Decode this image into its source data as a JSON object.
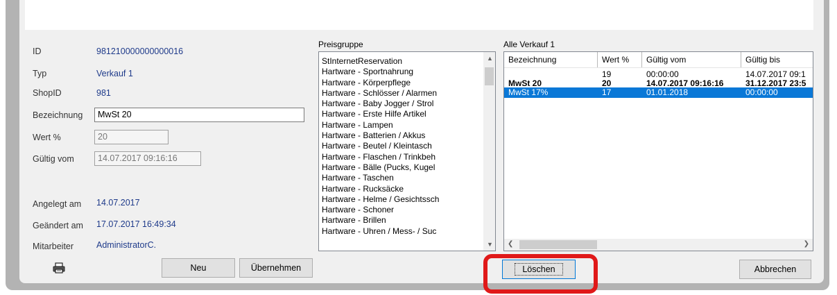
{
  "form": {
    "id_label": "ID",
    "id_value": "981210000000000016",
    "typ_label": "Typ",
    "typ_value": "Verkauf 1",
    "shopid_label": "ShopID",
    "shopid_value": "981",
    "bezeichnung_label": "Bezeichnung",
    "bezeichnung_value": "MwSt 20",
    "wert_label": "Wert %",
    "wert_value": "20",
    "gueltig_label": "Gültig vom",
    "gueltig_value": "14.07.2017 09:16:16",
    "angelegt_label": "Angelegt am",
    "angelegt_value": "14.07.2017",
    "geaendert_label": "Geändert am",
    "geaendert_value": "17.07.2017 16:49:34",
    "mitarbeiter_label": "Mitarbeiter",
    "mitarbeiter_value": "AdministratorC."
  },
  "preisgruppe": {
    "label": "Preisgruppe",
    "items": [
      "StInternetReservation",
      "Hartware - Sportnahrung",
      "Hartware - Körperpflege",
      "Hartware - Schlösser / Alarmen",
      "Hartware - Baby Jogger / Strol",
      "Hartware - Erste Hilfe Artikel",
      "Hartware - Lampen",
      "Hartware - Batterien / Akkus",
      "Hartware - Beutel / Kleintasch",
      "Hartware - Flaschen / Trinkbeh",
      "Hartware - Bälle (Pucks, Kugel",
      "Hartware - Taschen",
      "Hartware - Rucksäcke",
      "Hartware - Helme / Gesichtssch",
      "Hartware - Schoner",
      "Hartware - Brillen",
      "Hartware - Uhren / Mess- / Suc"
    ]
  },
  "grid": {
    "label": "Alle Verkauf 1",
    "columns": [
      "Bezeichnung",
      "Wert %",
      "Gültig vom",
      "Gültig bis"
    ],
    "rows": [
      {
        "bezeichnung": "",
        "wert": "19",
        "von": "00:00:00",
        "bis": "14.07.2017 09:1"
      },
      {
        "bezeichnung": "MwSt 20",
        "wert": "20",
        "von": "14.07.2017 09:16:16",
        "bis": "31.12.2017 23:5"
      },
      {
        "bezeichnung": "MwSt 17%",
        "wert": "17",
        "von": "01.01.2018",
        "bis": "00:00:00"
      }
    ],
    "selected_row": 2
  },
  "buttons": {
    "neu": "Neu",
    "uebernehmen": "Übernehmen",
    "loeschen": "Löschen",
    "abbrechen": "Abbrechen"
  },
  "colors": {
    "selection": "#0a78d7",
    "value_text": "#1e3a8a",
    "highlight": "#e01919"
  }
}
